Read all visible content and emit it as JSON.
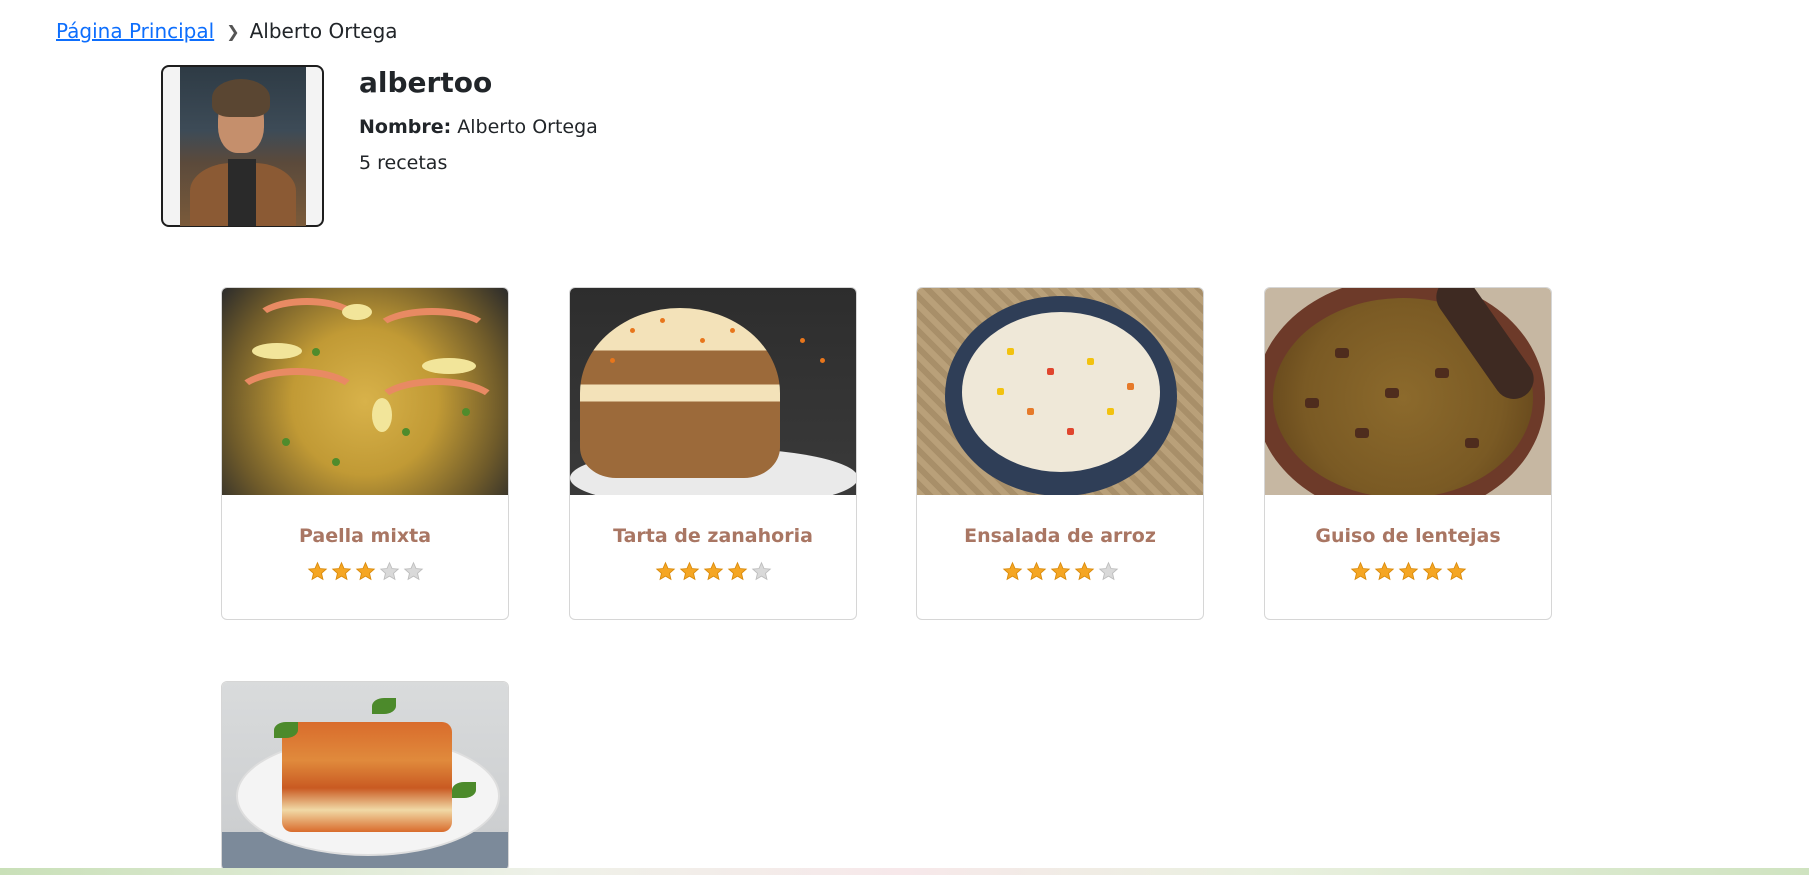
{
  "breadcrumb": {
    "home_label": "Página Principal",
    "separator_icon": "chevron-right-icon",
    "current_label": "Alberto Ortega"
  },
  "profile": {
    "username": "albertoo",
    "name_label": "Nombre:",
    "name_value": "Alberto Ortega",
    "recipe_count_text": "5 recetas"
  },
  "recipes": [
    {
      "title": "Paella mixta",
      "rating": 3,
      "max_rating": 5
    },
    {
      "title": "Tarta de zanahoria",
      "rating": 4,
      "max_rating": 5
    },
    {
      "title": "Ensalada de arroz",
      "rating": 4,
      "max_rating": 5
    },
    {
      "title": "Guiso de lentejas",
      "rating": 5,
      "max_rating": 5
    },
    {
      "title": "",
      "rating": null,
      "max_rating": 5
    }
  ],
  "colors": {
    "link": "#0d6efd",
    "recipe_title": "#a97663",
    "star_filled": "#f5a623",
    "star_empty": "#d9d9d9"
  }
}
